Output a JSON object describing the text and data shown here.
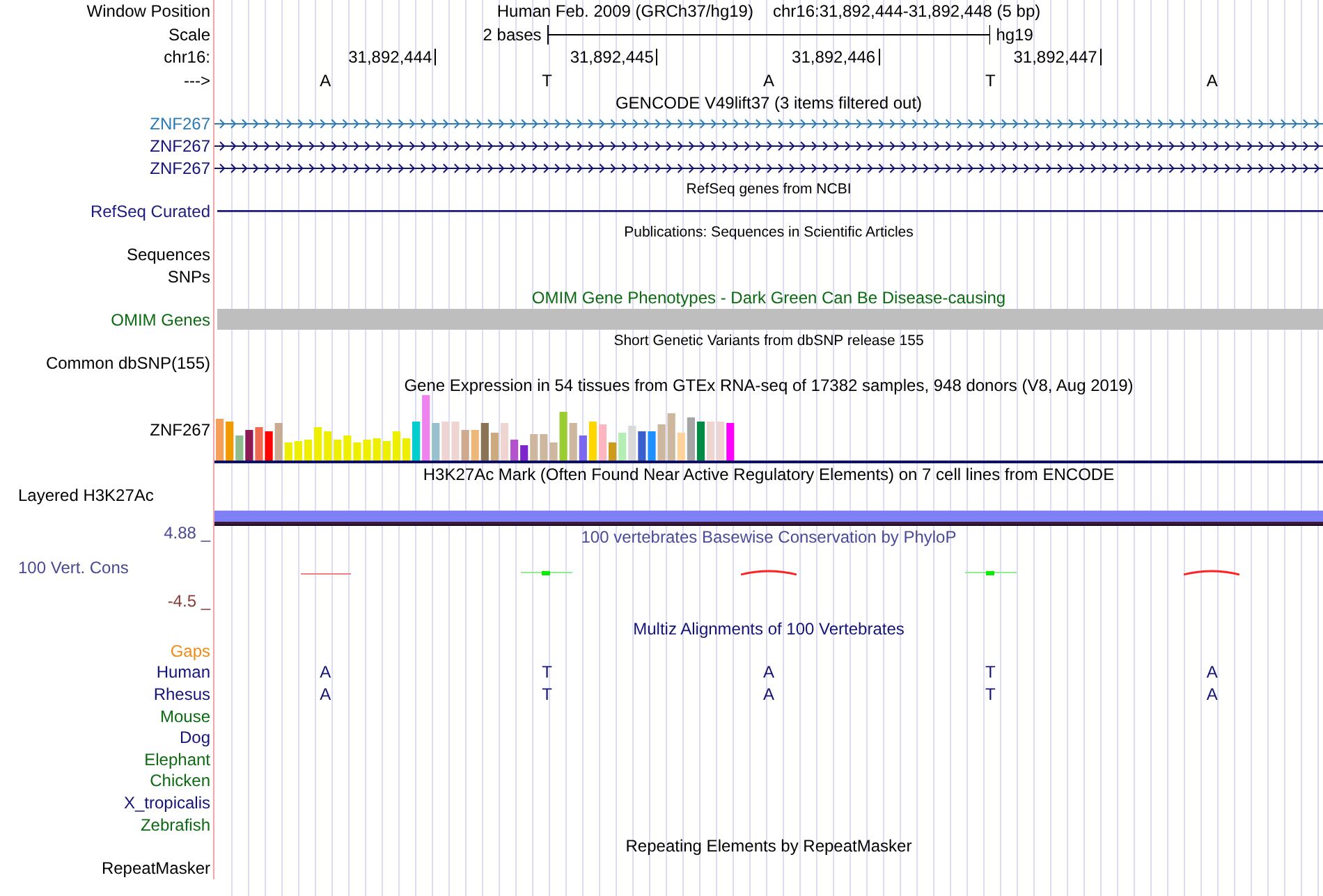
{
  "position": {
    "label": "Window Position",
    "assembly": "Human Feb. 2009 (GRCh37/hg19)",
    "region": "chr16:31,892,444-31,892,448 (5 bp)"
  },
  "scale": {
    "label": "Scale",
    "span": "2 bases",
    "assembly": "hg19"
  },
  "ruler": {
    "label": "chr16:",
    "positions": [
      "31,892,444",
      "31,892,445",
      "31,892,446",
      "31,892,447"
    ]
  },
  "strand": {
    "label": "--->",
    "bases": [
      "A",
      "T",
      "A",
      "T",
      "A"
    ]
  },
  "tracks": [
    {
      "kind": "title",
      "text": "GENCODE V49lift37 (3 items filtered out)",
      "color": "#000000"
    },
    {
      "kind": "gene",
      "label": "ZNF267",
      "color": "#2c7bb6"
    },
    {
      "kind": "gene",
      "label": "ZNF267",
      "color": "#141478"
    },
    {
      "kind": "gene",
      "label": "ZNF267",
      "color": "#141478"
    },
    {
      "kind": "small_title",
      "text": "RefSeq genes from NCBI"
    },
    {
      "kind": "line",
      "label": "RefSeq Curated",
      "color": "#1c1c80"
    },
    {
      "kind": "small_title",
      "text": "Publications: Sequences in Scientific Articles"
    },
    {
      "kind": "label",
      "label": "Sequences",
      "color": "#000000"
    },
    {
      "kind": "label",
      "label": "SNPs",
      "color": "#000000"
    },
    {
      "kind": "title",
      "text": "OMIM Gene Phenotypes - Dark Green Can Be Disease-causing",
      "color": "#0c6b12"
    },
    {
      "kind": "bar",
      "label": "OMIM Genes",
      "color": "#0c6b12"
    },
    {
      "kind": "small_title",
      "text": "Short Genetic Variants from dbSNP release 155"
    },
    {
      "kind": "label",
      "label": "Common dbSNP(155)",
      "color": "#000000"
    },
    {
      "kind": "title",
      "text": "Gene Expression in 54 tissues from GTEx RNA-seq of 17382 samples, 948 donors (V8, Aug 2019)",
      "color": "#000000"
    },
    {
      "kind": "expression",
      "label": "ZNF267",
      "color": "#000000"
    },
    {
      "kind": "title",
      "text": "H3K27Ac Mark (Often Found Near Active Regulatory Elements) on 7 cell lines from ENCODE",
      "color": "#000000"
    },
    {
      "kind": "layered",
      "label": "Layered H3K27Ac",
      "color": "#000000"
    },
    {
      "kind": "conservation",
      "text": "100 vertebrates Basewise Conservation by PhyloP",
      "label": "100 Vert. Cons",
      "max": "4.88 _",
      "min": "-4.5 _"
    },
    {
      "kind": "title",
      "text": "Multiz Alignments of 100 Vertebrates",
      "color": "#141478"
    },
    {
      "kind": "label",
      "label": "Gaps",
      "color": "#f08c14"
    },
    {
      "kind": "bases",
      "label": "Human",
      "color": "#141478",
      "bases": [
        "A",
        "T",
        "A",
        "T",
        "A"
      ]
    },
    {
      "kind": "bases",
      "label": "Rhesus",
      "color": "#141478",
      "bases": [
        "A",
        "T",
        "A",
        "T",
        "A"
      ]
    },
    {
      "kind": "label",
      "label": "Mouse",
      "color": "#0c6b12"
    },
    {
      "kind": "label",
      "label": "Dog",
      "color": "#141478"
    },
    {
      "kind": "label",
      "label": "Elephant",
      "color": "#0c6b12"
    },
    {
      "kind": "label",
      "label": "Chicken",
      "color": "#0c6b12"
    },
    {
      "kind": "label",
      "label": "X_tropicalis",
      "color": "#141478"
    },
    {
      "kind": "label",
      "label": "Zebrafish",
      "color": "#0c6b12"
    },
    {
      "kind": "title",
      "text": "Repeating Elements by RepeatMasker",
      "color": "#000000"
    },
    {
      "kind": "label",
      "label": "RepeatMasker",
      "color": "#000000"
    }
  ]
}
